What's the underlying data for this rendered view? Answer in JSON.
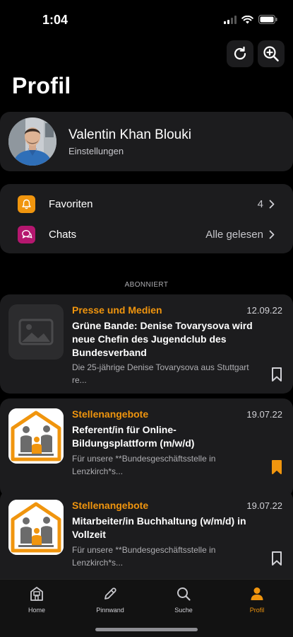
{
  "status_bar": {
    "time": "1:04"
  },
  "page": {
    "title": "Profil"
  },
  "profile": {
    "name": "Valentin Khan Blouki",
    "subtitle": "Einstellungen"
  },
  "menu": {
    "items": [
      {
        "label": "Favoriten",
        "value": "4",
        "icon": "bell-icon",
        "icon_color": "#f0950e"
      },
      {
        "label": "Chats",
        "value": "Alle gelesen",
        "icon": "chat-bubbles-icon",
        "icon_color": "#b5176f"
      }
    ]
  },
  "section": {
    "label": "ABONNIERT"
  },
  "news": [
    {
      "category": "Presse und Medien",
      "date": "12.09.22",
      "title": "Grüne Bande: Denise Tovarysova wird neue Chefin des Jugendclub des Bundesverband",
      "excerpt": "Die 25-jährige Denise Tovarysova aus Stuttgart re...",
      "thumbnail": "image-placeholder-icon",
      "bookmarked": false
    },
    {
      "category": "Stellenangebote",
      "date": "19.07.22",
      "title": "Referent/in für Online-Bildungsplattform (m/w/d)",
      "excerpt": "Für unsere **Bundesgeschäftsstelle in Lenzkirch*s...",
      "thumbnail": "people-logo",
      "bookmarked": true
    },
    {
      "category": "Stellenangebote",
      "date": "19.07.22",
      "title": "Mitarbeiter/in Buchhaltung (w/m/d) in Vollzeit",
      "excerpt": "Für unsere **Bundesgeschäftsstelle in Lenzkirch*s...",
      "thumbnail": "people-logo",
      "bookmarked": false
    }
  ],
  "tabs": [
    {
      "label": "Home",
      "icon": "home-icon",
      "active": false
    },
    {
      "label": "Pinnwand",
      "icon": "pencil-icon",
      "active": false
    },
    {
      "label": "Suche",
      "icon": "search-icon",
      "active": false
    },
    {
      "label": "Profil",
      "icon": "person-icon",
      "active": true
    }
  ],
  "colors": {
    "accent": "#f0950e",
    "card": "#1c1c1e",
    "background": "#000000"
  }
}
